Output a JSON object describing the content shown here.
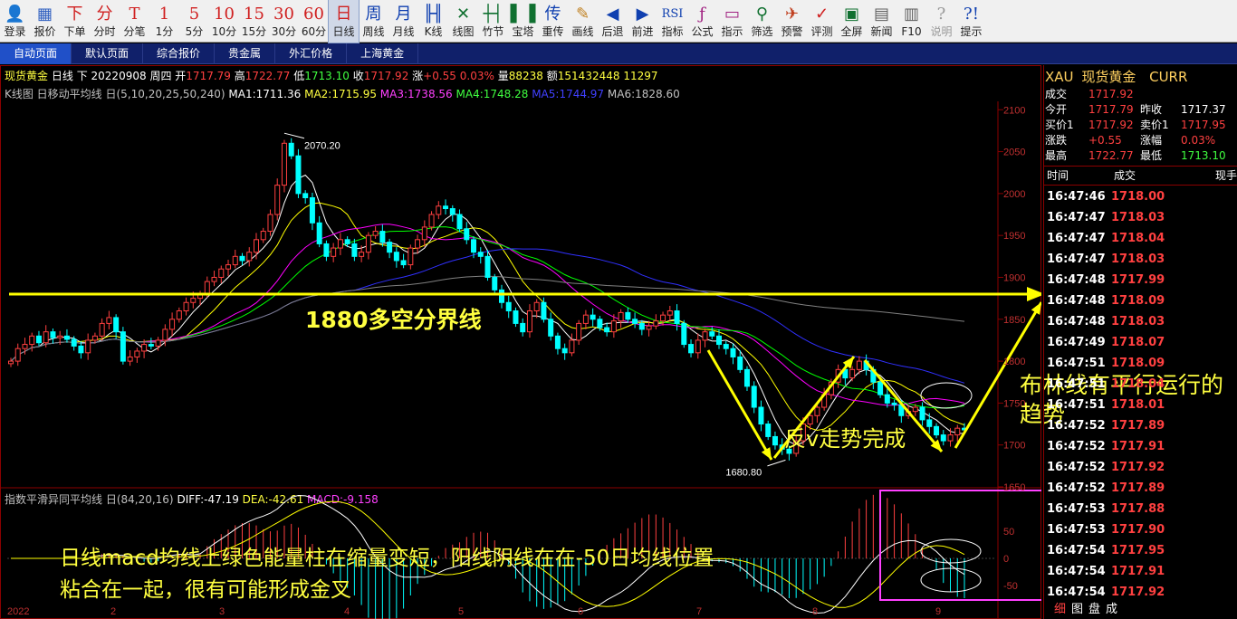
{
  "toolbar": [
    {
      "icon": "👤",
      "label": "登录",
      "name": "login-button",
      "color": "#3060c0"
    },
    {
      "icon": "▦",
      "label": "报价",
      "name": "quote-button",
      "color": "#3060c0"
    },
    {
      "icon": "下",
      "label": "下单",
      "name": "order-button",
      "color": "#d02020"
    },
    {
      "icon": "分",
      "label": "分时",
      "name": "intraday-button",
      "color": "#d02020"
    },
    {
      "icon": "T",
      "label": "分笔",
      "name": "tick-button",
      "color": "#d02020"
    },
    {
      "icon": "1",
      "label": "1分",
      "name": "period-1m-button",
      "color": "#d02020"
    },
    {
      "icon": "5",
      "label": "5分",
      "name": "period-5m-button",
      "color": "#d02020"
    },
    {
      "icon": "10",
      "label": "10分",
      "name": "period-10m-button",
      "color": "#d02020"
    },
    {
      "icon": "15",
      "label": "15分",
      "name": "period-15m-button",
      "color": "#d02020"
    },
    {
      "icon": "30",
      "label": "30分",
      "name": "period-30m-button",
      "color": "#d02020"
    },
    {
      "icon": "60",
      "label": "60分",
      "name": "period-60m-button",
      "color": "#d02020"
    },
    {
      "icon": "日",
      "label": "日线",
      "name": "period-daily-button",
      "color": "#d02020"
    },
    {
      "icon": "周",
      "label": "周线",
      "name": "period-weekly-button",
      "color": "#1040b0"
    },
    {
      "icon": "月",
      "label": "月线",
      "name": "period-monthly-button",
      "color": "#1040b0"
    },
    {
      "icon": "╟╢",
      "label": "K线",
      "name": "kline-button",
      "color": "#1040b0"
    },
    {
      "icon": "✕",
      "label": "线图",
      "name": "line-chart-button",
      "color": "#107030"
    },
    {
      "icon": "┼┤",
      "label": "竹节",
      "name": "bamboo-button",
      "color": "#107030"
    },
    {
      "icon": "▌▐",
      "label": "宝塔",
      "name": "tower-button",
      "color": "#107030"
    },
    {
      "icon": "传",
      "label": "重传",
      "name": "reload-button",
      "color": "#1040b0"
    },
    {
      "icon": "✎",
      "label": "画线",
      "name": "draw-line-button",
      "color": "#c08020"
    },
    {
      "icon": "◀",
      "label": "后退",
      "name": "back-button",
      "color": "#1040b0"
    },
    {
      "icon": "▶",
      "label": "前进",
      "name": "forward-button",
      "color": "#1040b0"
    },
    {
      "icon": "RSI",
      "label": "指标",
      "name": "indicator-button",
      "color": "#1040b0"
    },
    {
      "icon": "ƒ",
      "label": "公式",
      "name": "formula-button",
      "color": "#a02080"
    },
    {
      "icon": "▭",
      "label": "指示",
      "name": "signal-button",
      "color": "#a02080"
    },
    {
      "icon": "⚲",
      "label": "筛选",
      "name": "filter-button",
      "color": "#107030"
    },
    {
      "icon": "✈",
      "label": "预警",
      "name": "alert-button",
      "color": "#c04020"
    },
    {
      "icon": "✓",
      "label": "评测",
      "name": "evaluate-button",
      "color": "#d02020"
    },
    {
      "icon": "▣",
      "label": "全屏",
      "name": "fullscreen-button",
      "color": "#107030"
    },
    {
      "icon": "▤",
      "label": "新闻",
      "name": "news-button",
      "color": "#606060"
    },
    {
      "icon": "▥",
      "label": "F10",
      "name": "f10-button",
      "color": "#606060"
    },
    {
      "icon": "?",
      "label": "说明",
      "name": "help-doc-button",
      "color": "#999999"
    },
    {
      "icon": "?!",
      "label": "提示",
      "name": "tips-button",
      "color": "#1040b0"
    }
  ],
  "tabs": [
    "自动页面",
    "默认页面",
    "综合报价",
    "贵金属",
    "外汇价格",
    "上海黄金"
  ],
  "header": {
    "name": "现货黄金",
    "period": "日线",
    "dir": "下",
    "date": "20220908",
    "weekday": "周四",
    "open_label": "开",
    "open": "1717.79",
    "high_label": "高",
    "high": "1722.77",
    "low_label": "低",
    "low": "1713.10",
    "close_label": "收",
    "close": "1717.92",
    "chg_label": "涨",
    "chg": "+0.55",
    "chg_pct": "0.03%",
    "vol_label": "量",
    "vol": "88238",
    "amt_label": "额",
    "amt": "151432448",
    "oi": "11297"
  },
  "ma_header": {
    "title": "K线图 日移动平均线 日(5,10,20,25,50,240)",
    "ma1": "MA1:1711.36",
    "ma2": "MA2:1715.95",
    "ma3": "MA3:1738.56",
    "ma4": "MA4:1748.28",
    "ma5": "MA5:1744.97",
    "ma6": "MA6:1828.60"
  },
  "macd_header": {
    "title": "指数平滑异同平均线 日(84,20,16)",
    "diff": "DIFF:-47.19",
    "dea": "DEA:-42.61",
    "macd": "MACD:-9.158"
  },
  "colors": {
    "up": "#ff4040",
    "down": "#00ffff",
    "ma1": "#ffffff",
    "ma2": "#ffff00",
    "ma3": "#ff00ff",
    "ma4": "#00ff00",
    "ma5": "#3030ff",
    "ma6": "#808080",
    "grid": "#8b0000",
    "annot": "#ffff00"
  },
  "chart_data": [
    {
      "type": "candlestick",
      "y_ticks": [
        "2100",
        "2050",
        "2000",
        "1950",
        "1900",
        "1850",
        "1800",
        "1750",
        "1700",
        "1650"
      ],
      "ylim": [
        1650,
        2110
      ],
      "x_ticks": [
        "2022",
        "2",
        "3",
        "4",
        "5",
        "6",
        "7",
        "8",
        "9"
      ],
      "peak_label": "2070.20",
      "trough_label": "1680.80",
      "closes": [
        1800,
        1815,
        1820,
        1830,
        1822,
        1835,
        1828,
        1830,
        1826,
        1818,
        1810,
        1825,
        1830,
        1845,
        1852,
        1835,
        1800,
        1805,
        1812,
        1820,
        1818,
        1825,
        1838,
        1850,
        1860,
        1870,
        1875,
        1880,
        1895,
        1900,
        1910,
        1915,
        1925,
        1920,
        1930,
        1945,
        1955,
        1975,
        2010,
        2060,
        2045,
        2000,
        1995,
        1965,
        1940,
        1925,
        1935,
        1945,
        1940,
        1925,
        1930,
        1950,
        1955,
        1942,
        1930,
        1920,
        1915,
        1935,
        1945,
        1960,
        1975,
        1985,
        1982,
        1975,
        1958,
        1945,
        1930,
        1925,
        1900,
        1885,
        1870,
        1860,
        1845,
        1835,
        1860,
        1870,
        1850,
        1830,
        1815,
        1810,
        1825,
        1845,
        1855,
        1850,
        1840,
        1835,
        1848,
        1858,
        1850,
        1845,
        1838,
        1842,
        1848,
        1855,
        1860,
        1845,
        1820,
        1810,
        1825,
        1835,
        1830,
        1820,
        1815,
        1805,
        1790,
        1770,
        1745,
        1725,
        1710,
        1700,
        1695,
        1690,
        1705,
        1725,
        1735,
        1745,
        1760,
        1775,
        1790,
        1780,
        1790,
        1800,
        1790,
        1775,
        1760,
        1750,
        1748,
        1735,
        1740,
        1745,
        1730,
        1722,
        1712,
        1705,
        1712,
        1720,
        1718
      ]
    },
    {
      "type": "macd",
      "y_ticks": [
        "50",
        "0",
        "-50"
      ],
      "ylim": [
        -65,
        75
      ]
    }
  ],
  "annotations": {
    "line1880": "1880多空分界线",
    "reverse_v": "反v走势完成",
    "boll": "布林线有平行运行的趋势",
    "macd_note_l1": "日线macd均线上绿色能量柱在缩量变短，阳线阴线在在-50日均线位置",
    "macd_note_l2": "粘合在一起，很有可能形成金叉"
  },
  "side": {
    "symbol": "XAU",
    "symbol_name": "现货黄金",
    "symbol_unit": "CURR",
    "rows": [
      {
        "l1": "成交",
        "v1": "1717.92",
        "l2": "",
        "v2": "",
        "c1": "#ff4040",
        "c2": "#ffffff"
      },
      {
        "l1": "今开",
        "v1": "1717.79",
        "l2": "昨收",
        "v2": "1717.37",
        "c1": "#ff4040",
        "c2": "#ffffff"
      },
      {
        "l1": "买价1",
        "v1": "1717.92",
        "l2": "卖价1",
        "v2": "1717.95",
        "c1": "#ff4040",
        "c2": "#ff4040"
      },
      {
        "l1": "涨跌",
        "v1": "+0.55",
        "l2": "涨幅",
        "v2": "0.03%",
        "c1": "#ff4040",
        "c2": "#ff4040"
      },
      {
        "l1": "最高",
        "v1": "1722.77",
        "l2": "最低",
        "v2": "1713.10",
        "c1": "#ff4040",
        "c2": "#40ff40"
      }
    ],
    "ticks_header": {
      "time": "时间",
      "price": "成交",
      "now": "现手"
    },
    "ticks": [
      {
        "time": "16:47:46",
        "price": "1718.00"
      },
      {
        "time": "16:47:47",
        "price": "1718.03"
      },
      {
        "time": "16:47:47",
        "price": "1718.04"
      },
      {
        "time": "16:47:47",
        "price": "1718.03"
      },
      {
        "time": "16:47:48",
        "price": "1717.99"
      },
      {
        "time": "16:47:48",
        "price": "1718.09"
      },
      {
        "time": "16:47:48",
        "price": "1718.03"
      },
      {
        "time": "16:47:49",
        "price": "1718.07"
      },
      {
        "time": "16:47:51",
        "price": "1718.09"
      },
      {
        "time": "16:47:51",
        "price": "1718.04"
      },
      {
        "time": "16:47:51",
        "price": "1718.01"
      },
      {
        "time": "16:47:52",
        "price": "1717.89"
      },
      {
        "time": "16:47:52",
        "price": "1717.91"
      },
      {
        "time": "16:47:52",
        "price": "1717.92"
      },
      {
        "time": "16:47:52",
        "price": "1717.89"
      },
      {
        "time": "16:47:53",
        "price": "1717.88"
      },
      {
        "time": "16:47:53",
        "price": "1717.90"
      },
      {
        "time": "16:47:54",
        "price": "1717.95"
      },
      {
        "time": "16:47:54",
        "price": "1717.91"
      },
      {
        "time": "16:47:54",
        "price": "1717.92"
      }
    ],
    "bottom_tabs": [
      "细",
      "图",
      "盘",
      "成"
    ]
  }
}
